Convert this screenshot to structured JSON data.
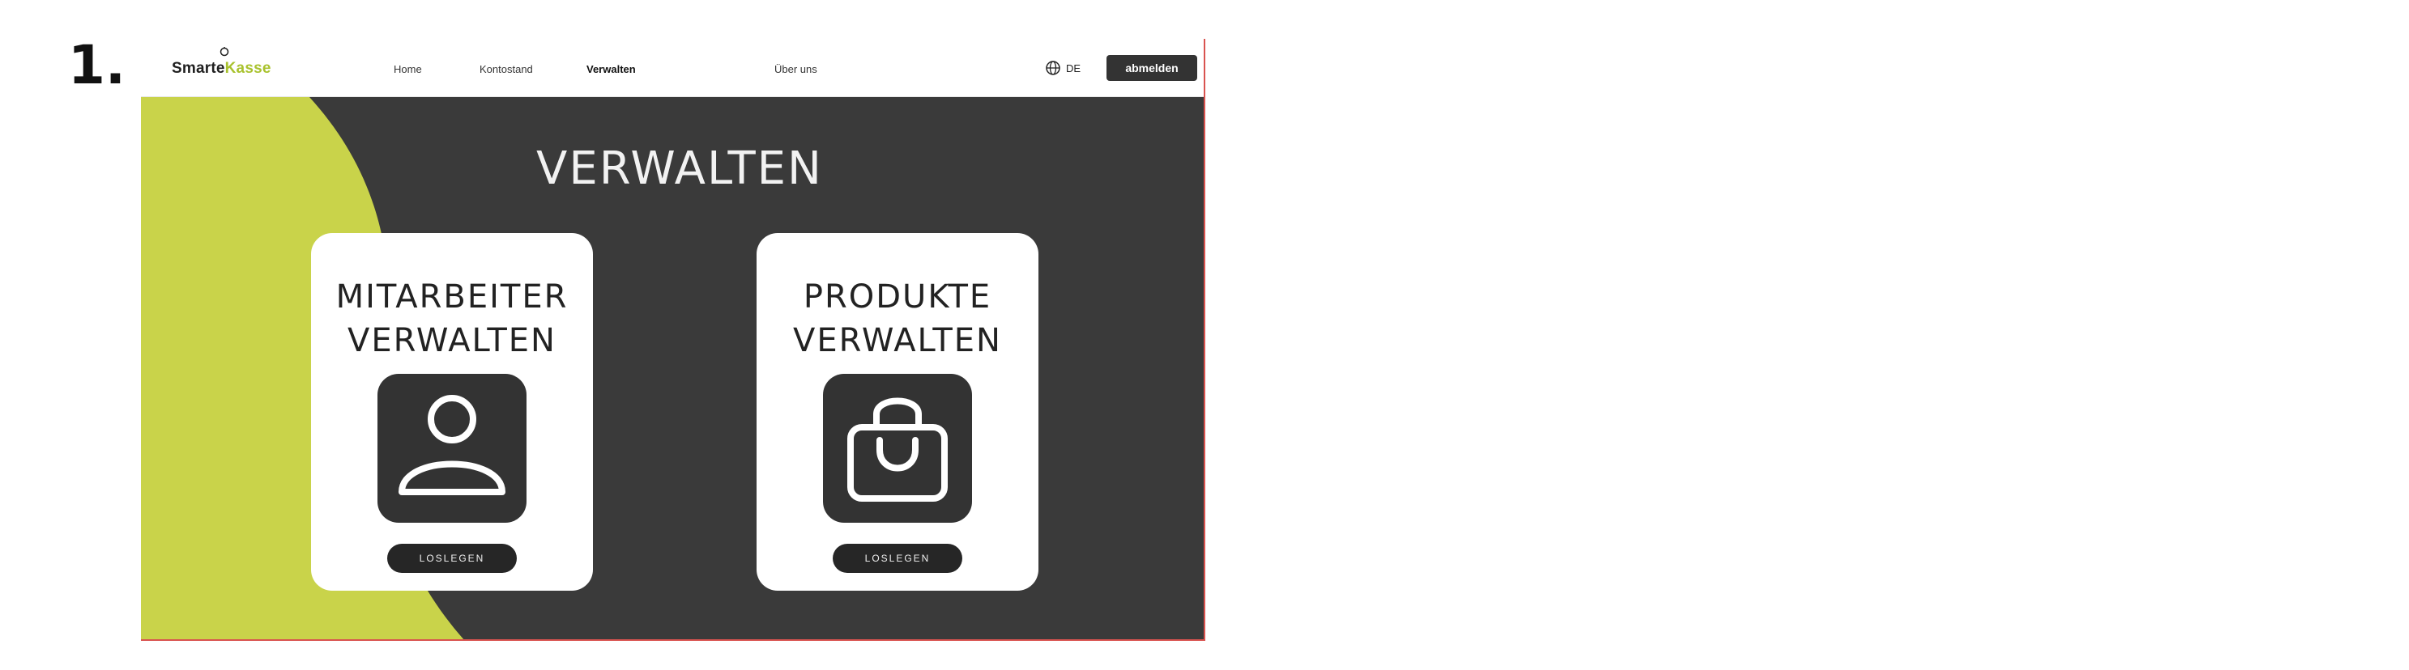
{
  "step_number": "1.",
  "header": {
    "logo_part1": "Smarte",
    "logo_part2": "Kasse",
    "nav": [
      {
        "label": "Home"
      },
      {
        "label": "Kontostand"
      },
      {
        "label": "Verwalten"
      },
      {
        "label": "Über uns"
      }
    ],
    "active_nav": "Verwalten",
    "language": "DE",
    "logout_label": "abmelden"
  },
  "main": {
    "title": "VERWALTEN",
    "cards": [
      {
        "title": "MITARBEITER\nVERWALTEN",
        "icon": "user-icon",
        "button_label": "LOSLEGEN"
      },
      {
        "title": "PRODUKTE\nVERWALTEN",
        "icon": "shopping-bag-icon",
        "button_label": "LOSLEGEN"
      }
    ]
  },
  "colors": {
    "accent_lime": "#c9d34a",
    "dark_background": "#3a3a3a",
    "button_dark": "#333333",
    "logo_green": "#a9c22e"
  }
}
